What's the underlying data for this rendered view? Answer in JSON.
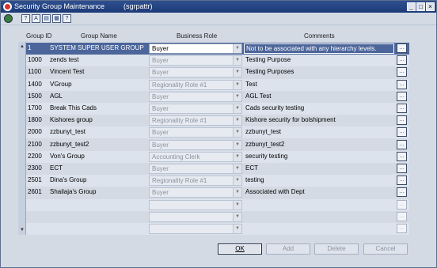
{
  "window": {
    "title": "Security Group Maintenance",
    "id": "(sgrpattr)",
    "controls": [
      "minimize-icon",
      "maximize-icon",
      "close-icon"
    ]
  },
  "toolbar": {
    "icons": [
      "globe-icon",
      "help-search-icon",
      "spellcheck-icon",
      "copy-icon",
      "print-icon",
      "help-icon"
    ]
  },
  "columns": {
    "group_id": "Group ID",
    "group_name": "Group Name",
    "business_role": "Business Role",
    "comments": "Comments"
  },
  "rows": [
    {
      "id": "1",
      "name": "SYSTEM SUPER USER GROUP",
      "role": "Buyer",
      "comment": "Not to be associated with any hierarchy levels.",
      "selected": true
    },
    {
      "id": "1000",
      "name": "zends test",
      "role": "Buyer",
      "comment": "Testing Purpose"
    },
    {
      "id": "1100",
      "name": "Vincent Test",
      "role": "Buyer",
      "comment": "Testing Purposes"
    },
    {
      "id": "1400",
      "name": "VGroup",
      "role": "Regionality Role #1",
      "comment": "Test"
    },
    {
      "id": "1500",
      "name": "AGL",
      "role": "Buyer",
      "comment": "AGL Test"
    },
    {
      "id": "1700",
      "name": "Break This Cads",
      "role": "Buyer",
      "comment": "Cads security testing"
    },
    {
      "id": "1800",
      "name": "Kishores group",
      "role": "Regionality Role #1",
      "comment": "Kishore security for bolshipment"
    },
    {
      "id": "2000",
      "name": "zzbunyt_test",
      "role": "Buyer",
      "comment": "zzbunyt_test"
    },
    {
      "id": "2100",
      "name": "zzbunyt_test2",
      "role": "Buyer",
      "comment": "zzbunyt_test2"
    },
    {
      "id": "2200",
      "name": "Von's Group",
      "role": "Accounting Clerk",
      "comment": "security testing"
    },
    {
      "id": "2300",
      "name": "ECT",
      "role": "Buyer",
      "comment": "ECT"
    },
    {
      "id": "2501",
      "name": "Dina's Group",
      "role": "Regionality Role #1",
      "comment": "testing"
    },
    {
      "id": "2601",
      "name": "Shailaja's Group",
      "role": "Buyer",
      "comment": "Associated with Dept"
    },
    {
      "id": "",
      "name": "",
      "role": "",
      "comment": ""
    },
    {
      "id": "",
      "name": "",
      "role": "",
      "comment": ""
    },
    {
      "id": "",
      "name": "",
      "role": "",
      "comment": ""
    }
  ],
  "buttons": {
    "ok": "OK",
    "add": "Add",
    "delete": "Delete",
    "cancel": "Cancel"
  },
  "colors": {
    "titlebar": "#1c3a78",
    "selected_row": "#4c669b",
    "background": "#d3dae4"
  }
}
